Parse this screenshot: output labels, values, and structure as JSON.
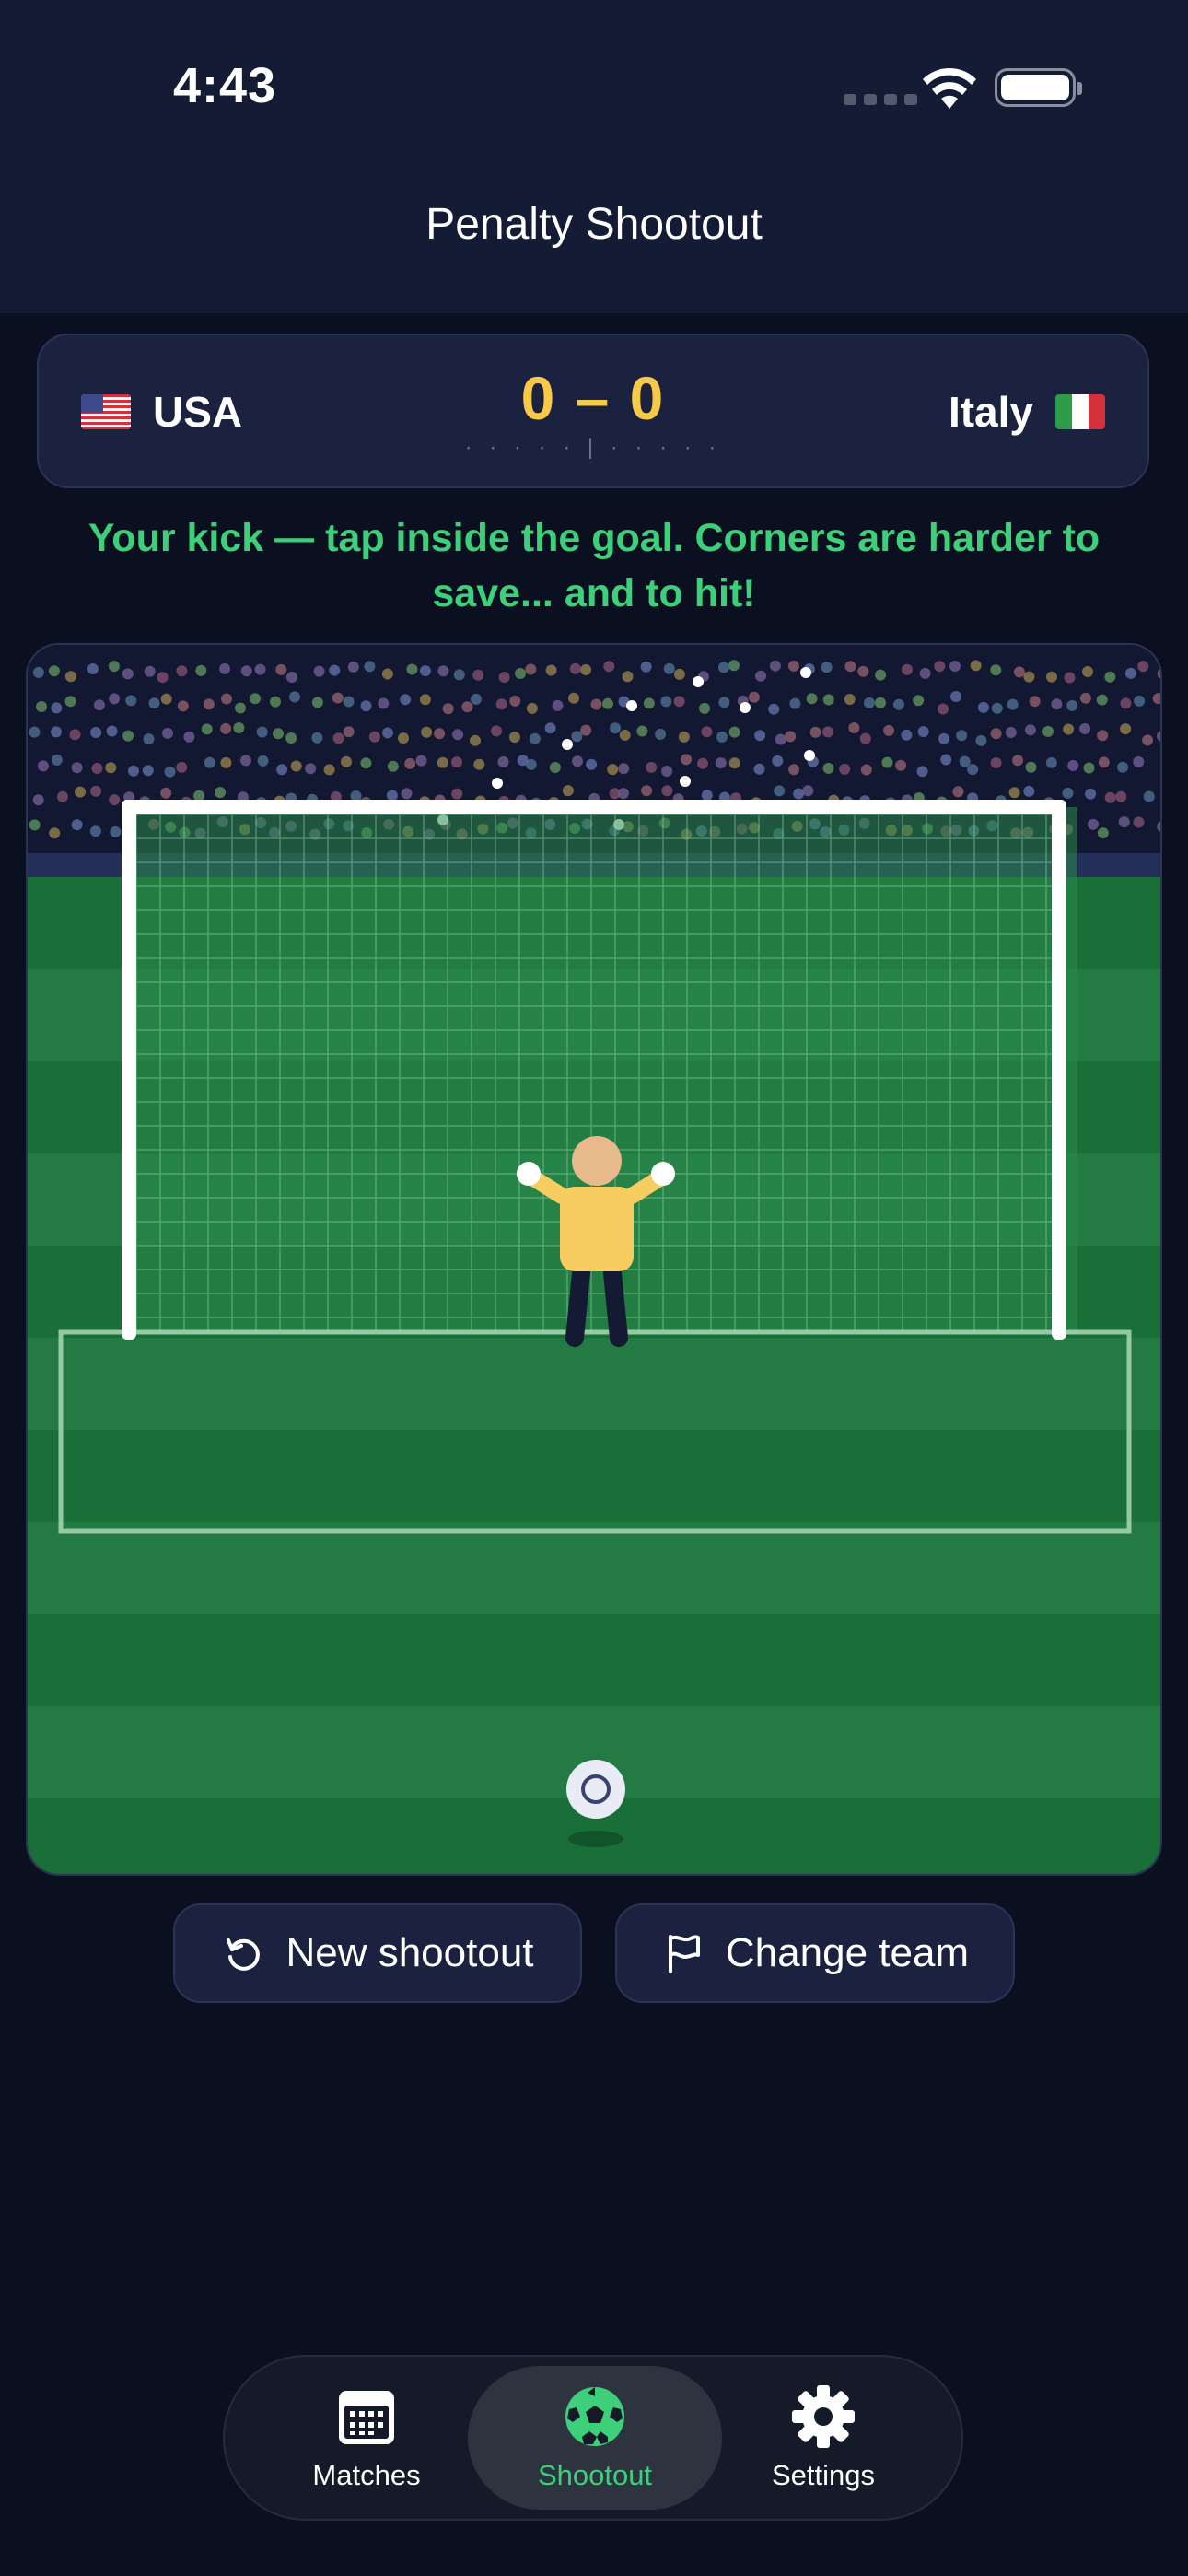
{
  "status_bar": {
    "time": "4:43"
  },
  "header": {
    "title": "Penalty Shootout"
  },
  "scoreboard": {
    "home": {
      "name": "USA",
      "flag_icon": "us-flag-icon"
    },
    "away": {
      "name": "Italy",
      "flag_icon": "italy-flag-icon"
    },
    "score": "0 – 0",
    "kicks": "· · · · ·   |   · · · · ·"
  },
  "instruction": "Your kick — tap inside the goal. Corners are harder to save... and to hit!",
  "actions": {
    "new_shootout": {
      "label": "New shootout",
      "icon": "restart-icon"
    },
    "change_team": {
      "label": "Change team",
      "icon": "flag-icon"
    }
  },
  "tabbar": {
    "selected": "Shootout",
    "items": [
      {
        "label": "Matches",
        "icon": "calendar-icon"
      },
      {
        "label": "Shootout",
        "icon": "soccer-ball-icon"
      },
      {
        "label": "Settings",
        "icon": "gear-icon"
      }
    ]
  },
  "colors": {
    "background": "#0b1020",
    "header": "#141b35",
    "card": "#1b2240",
    "accent_green": "#3ecf7a",
    "score_yellow": "#f6c948",
    "pitch_dark": "#1a6e38",
    "pitch_light": "#237a42",
    "keeper_shirt": "#f7cc61"
  }
}
